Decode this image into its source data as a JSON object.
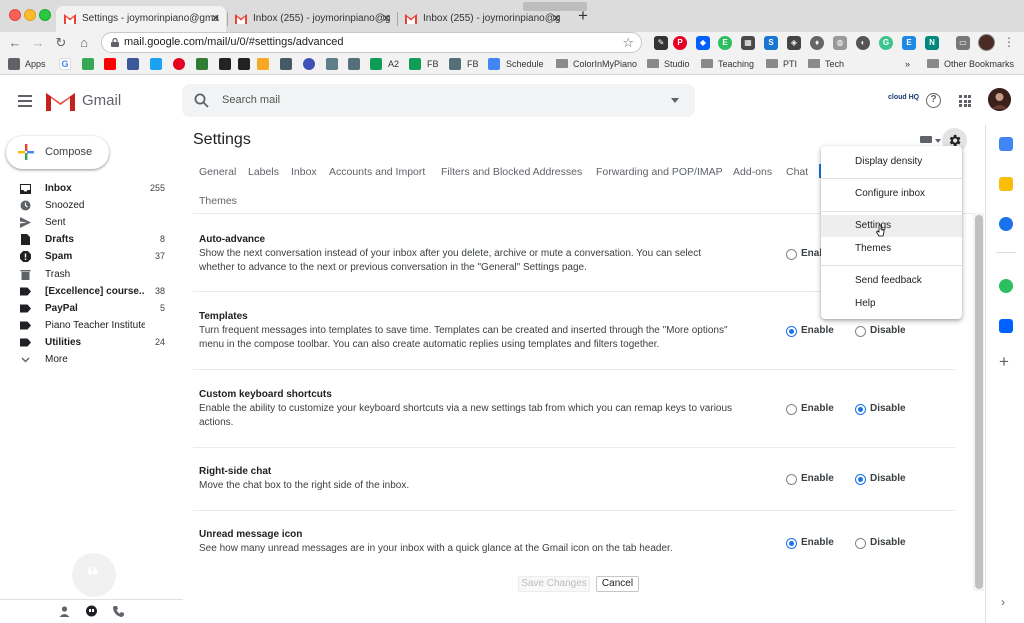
{
  "browser": {
    "tabs": [
      {
        "title": "Settings - joymorinpiano@gma",
        "close": "✕"
      },
      {
        "title": "Inbox (255) - joymorinpiano@g",
        "close": "✕"
      },
      {
        "title": "Inbox (255) - joymorinpiano@g",
        "close": "✕"
      }
    ],
    "new_tab": "+",
    "url": "mail.google.com/mail/u/0/#settings/advanced",
    "bookmarks": [
      {
        "label": "Apps"
      },
      {
        "label": "A2"
      },
      {
        "label": "FB"
      },
      {
        "label": "FB"
      },
      {
        "label": "Schedule"
      },
      {
        "label": "ColorInMyPiano"
      },
      {
        "label": "Studio"
      },
      {
        "label": "Teaching"
      },
      {
        "label": "PTI"
      },
      {
        "label": "Tech"
      },
      {
        "label": "»"
      },
      {
        "label": "Other Bookmarks"
      }
    ]
  },
  "gmail": {
    "brand": "Gmail",
    "search_placeholder": "Search mail",
    "cloudhq": "cloud HQ",
    "compose": "Compose",
    "nav": [
      {
        "label": "Inbox",
        "count": "255",
        "bold": true,
        "icon": "inbox-icon"
      },
      {
        "label": "Snoozed",
        "count": "",
        "bold": false,
        "icon": "clock-icon"
      },
      {
        "label": "Sent",
        "count": "",
        "bold": false,
        "icon": "send-icon"
      },
      {
        "label": "Drafts",
        "count": "8",
        "bold": true,
        "icon": "draft-icon"
      },
      {
        "label": "Spam",
        "count": "37",
        "bold": true,
        "icon": "spam-icon"
      },
      {
        "label": "Trash",
        "count": "",
        "bold": false,
        "icon": "trash-icon"
      },
      {
        "label": "[Excellence] course...",
        "count": "38",
        "bold": true,
        "icon": "label-icon"
      },
      {
        "label": "PayPal",
        "count": "5",
        "bold": true,
        "icon": "label-icon"
      },
      {
        "label": "Piano Teacher Institute",
        "count": "",
        "bold": false,
        "icon": "label-icon"
      },
      {
        "label": "Utilities",
        "count": "24",
        "bold": true,
        "icon": "label-icon"
      },
      {
        "label": "More",
        "count": "",
        "bold": false,
        "icon": "chevron-down-icon"
      }
    ]
  },
  "settings": {
    "title": "Settings",
    "tabs": [
      "General",
      "Labels",
      "Inbox",
      "Accounts and Import",
      "Filters and Blocked Addresses",
      "Forwarding and POP/IMAP",
      "Add-ons",
      "Chat",
      "Themes"
    ],
    "items": [
      {
        "title": "Auto-advance",
        "desc": "Show the next conversation instead of your inbox after you delete, archive or mute a conversation. You can select whether to advance to the next or previous conversation in the \"General\" Settings page.",
        "enable": "Enab",
        "disable": "",
        "selected": "none"
      },
      {
        "title": "Templates",
        "desc": "Turn frequent messages into templates to save time. Templates can be created and inserted through the \"More options\" menu in the compose toolbar. You can also create automatic replies using templates and filters together.",
        "enable": "Enable",
        "disable": "Disable",
        "selected": "enable"
      },
      {
        "title": "Custom keyboard shortcuts",
        "desc": "Enable the ability to customize your keyboard shortcuts via a new settings tab from which you can remap keys to various actions.",
        "enable": "Enable",
        "disable": "Disable",
        "selected": "disable"
      },
      {
        "title": "Right-side chat",
        "desc": "Move the chat box to the right side of the inbox.",
        "enable": "Enable",
        "disable": "Disable",
        "selected": "disable"
      },
      {
        "title": "Unread message icon",
        "desc": "See how many unread messages are in your inbox with a quick glance at the Gmail icon on the tab header.",
        "enable": "Enable",
        "disable": "Disable",
        "selected": "enable"
      }
    ],
    "save": "Save Changes",
    "cancel": "Cancel"
  },
  "menu": {
    "items": [
      "Display density",
      "Configure inbox",
      "Settings",
      "Themes",
      "Send feedback",
      "Help"
    ],
    "hovered": "Settings"
  },
  "colors": {
    "accent": "#1a73e8",
    "gmail_red": "#ea4335"
  }
}
